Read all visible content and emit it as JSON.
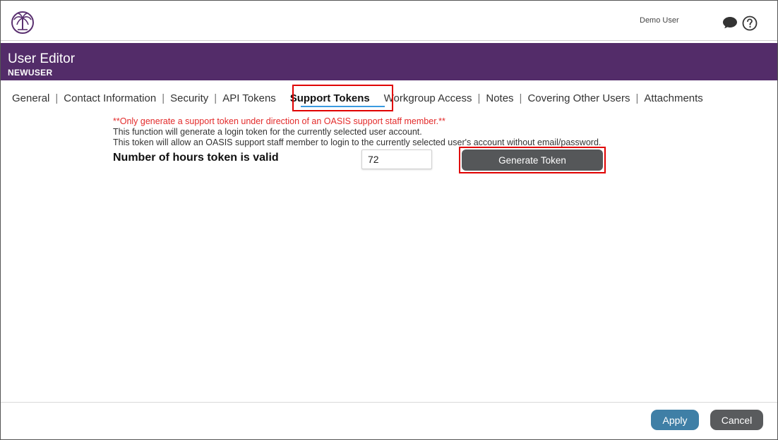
{
  "topbar": {
    "user_name": "Demo User",
    "logo_icon": "palm-tree-logo-icon",
    "chat_icon": "chat-bubble-icon",
    "help_icon": "help-circle-icon"
  },
  "header": {
    "title": "User Editor",
    "subtitle": "NEWUSER",
    "background_color": "#532c69"
  },
  "tabs": [
    {
      "label": "General",
      "active": false
    },
    {
      "label": "Contact Information",
      "active": false
    },
    {
      "label": "Security",
      "active": false
    },
    {
      "label": "API Tokens",
      "active": false
    },
    {
      "label": "Support Tokens",
      "active": true
    },
    {
      "label": "Workgroup Access",
      "active": false
    },
    {
      "label": "Notes",
      "active": false
    },
    {
      "label": "Covering Other Users",
      "active": false
    },
    {
      "label": "Attachments",
      "active": false
    }
  ],
  "support_tokens": {
    "warning": "**Only generate a support token under direction of an OASIS support staff member.**",
    "description_1": "This function will generate a login token for the currently selected user account.",
    "description_2": "This token will allow an OASIS support staff member to login to the currently selected user's account without email/password.",
    "hours_label": "Number of hours token is valid",
    "hours_value": "72",
    "generate_button": "Generate Token"
  },
  "footer": {
    "apply_label": "Apply",
    "cancel_label": "Cancel"
  },
  "colors": {
    "accent_purple": "#532c69",
    "warning_red": "#e32b2b",
    "apply_blue": "#3f7fa6",
    "highlight_red": "#e00000"
  }
}
